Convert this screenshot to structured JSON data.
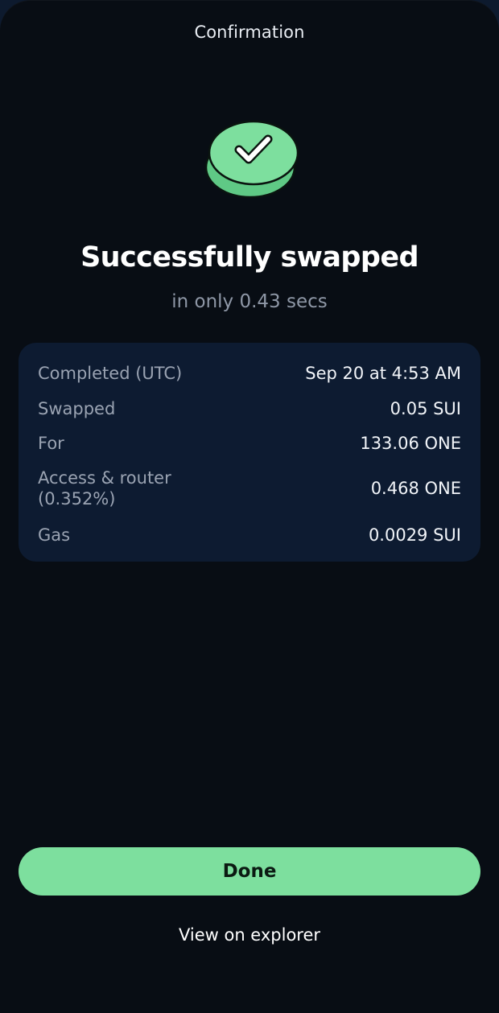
{
  "header": {
    "title": "Confirmation"
  },
  "status": {
    "icon": "check-coin-icon",
    "headline": "Successfully swapped",
    "subline": "in only 0.43 secs"
  },
  "details": {
    "rows": [
      {
        "label": "Completed (UTC)",
        "value": "Sep 20 at 4:53 AM"
      },
      {
        "label": "Swapped",
        "value": "0.05 SUI"
      },
      {
        "label": "For",
        "value": "133.06 ONE"
      },
      {
        "label": "Access & router (0.352%)",
        "value": "0.468 ONE"
      },
      {
        "label": "Gas",
        "value": "0.0029 SUI"
      }
    ]
  },
  "actions": {
    "done_label": "Done",
    "explorer_label": "View on explorer"
  },
  "colors": {
    "background": "#080d14",
    "card": "#0d1b31",
    "accent": "#7ddf9e"
  }
}
